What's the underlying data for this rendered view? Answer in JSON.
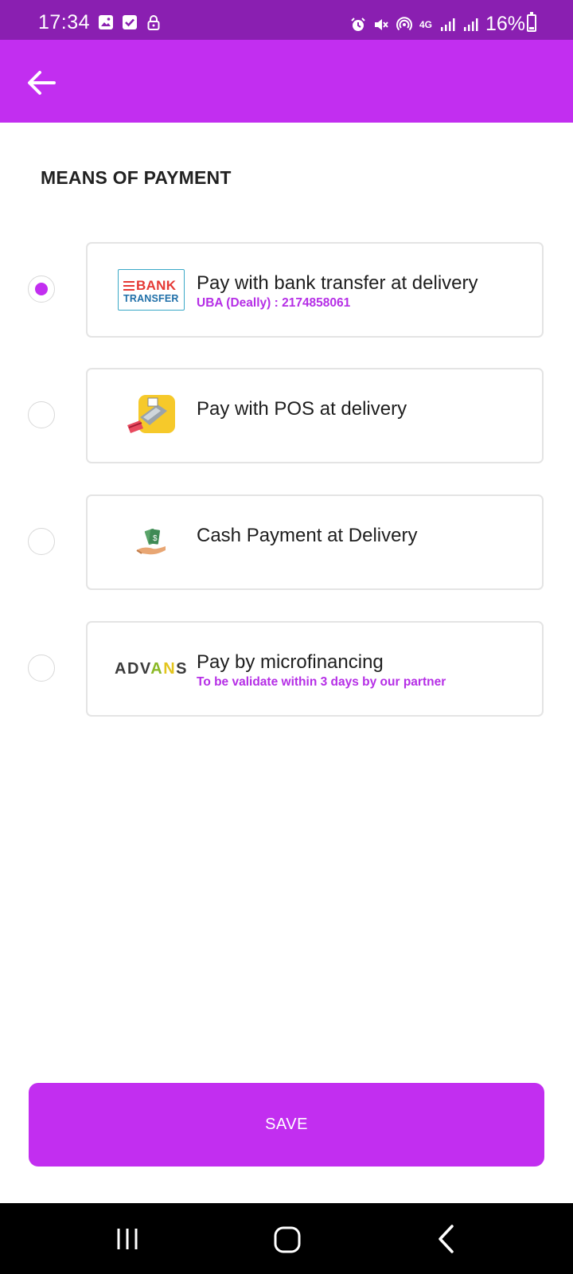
{
  "status_bar": {
    "time": "17:34",
    "battery_percent": "16%",
    "network": "4G",
    "battery_level": 0.16,
    "left_icons": [
      "gallery-icon",
      "check-box-icon",
      "lock-icon"
    ],
    "right_icons": [
      "alarm-icon",
      "mute-icon",
      "hotspot-icon",
      "4g-icon",
      "signal-icon",
      "signal-icon"
    ]
  },
  "app_bar": {
    "back_icon": "arrow-left-icon",
    "background": "#c22ef0"
  },
  "section": {
    "title": "MEANS OF PAYMENT"
  },
  "payment_options": [
    {
      "label": "Pay with bank transfer at delivery",
      "sublabel": "UBA (Deally) : 2174858061",
      "selected": true,
      "logo": "bank-transfer-logo",
      "logo_text_1": "BANK",
      "logo_text_2": "TRANSFER"
    },
    {
      "label": "Pay with POS at delivery",
      "selected": false,
      "logo": "pos-terminal-icon"
    },
    {
      "label": "Cash Payment at Delivery",
      "selected": false,
      "logo": "cash-hand-icon"
    },
    {
      "label": "Pay by microfinancing",
      "sublabel": "To be validate within 3 days by our partner",
      "selected": false,
      "logo": "advans-logo",
      "logo_text": "ADVANS"
    }
  ],
  "actions": {
    "save_label": "SAVE"
  },
  "nav_bar": {
    "icons": [
      "recents-icon",
      "home-icon",
      "back-icon"
    ]
  },
  "colors": {
    "accent": "#c22ef0",
    "status_bar": "#8a1fb1",
    "sublabel": "#b52ee6"
  }
}
